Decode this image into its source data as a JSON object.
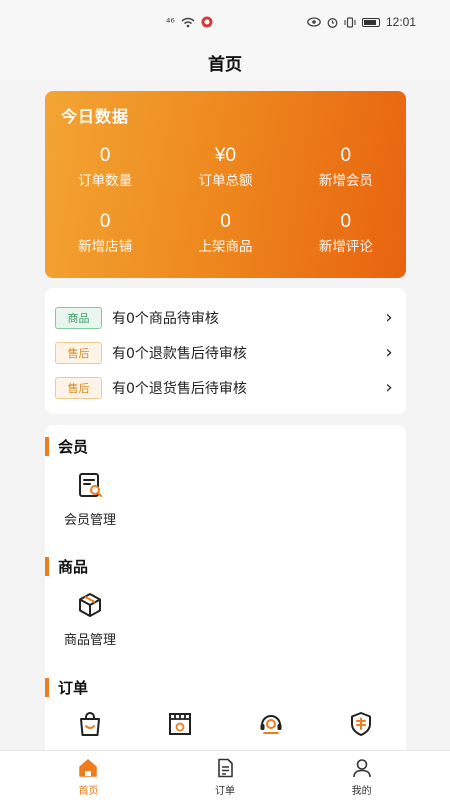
{
  "status_bar": {
    "time": "12:01"
  },
  "nav": {
    "title": "首页"
  },
  "today": {
    "title": "今日数据",
    "stats": [
      {
        "value": "0",
        "label": "订单数量"
      },
      {
        "value": "¥0",
        "label": "订单总额"
      },
      {
        "value": "0",
        "label": "新增会员"
      },
      {
        "value": "0",
        "label": "新增店铺"
      },
      {
        "value": "0",
        "label": "上架商品"
      },
      {
        "value": "0",
        "label": "新增评论"
      }
    ]
  },
  "audits": [
    {
      "tag": "商品",
      "text": "有0个商品待审核"
    },
    {
      "tag": "售后",
      "text": "有0个退款售后待审核"
    },
    {
      "tag": "售后",
      "text": "有0个退货售后待审核"
    }
  ],
  "sections": {
    "member": {
      "title": "会员",
      "item": "会员管理"
    },
    "goods": {
      "title": "商品",
      "item": "商品管理"
    },
    "order": {
      "title": "订单"
    }
  },
  "tabs": [
    {
      "label": "首页"
    },
    {
      "label": "订单"
    },
    {
      "label": "我的"
    }
  ],
  "colors": {
    "accent": "#ef7d1d",
    "card_start": "#f3a533",
    "card_end": "#e8630f",
    "tag_green": "#3c9c64",
    "tag_orange": "#d98a22"
  }
}
